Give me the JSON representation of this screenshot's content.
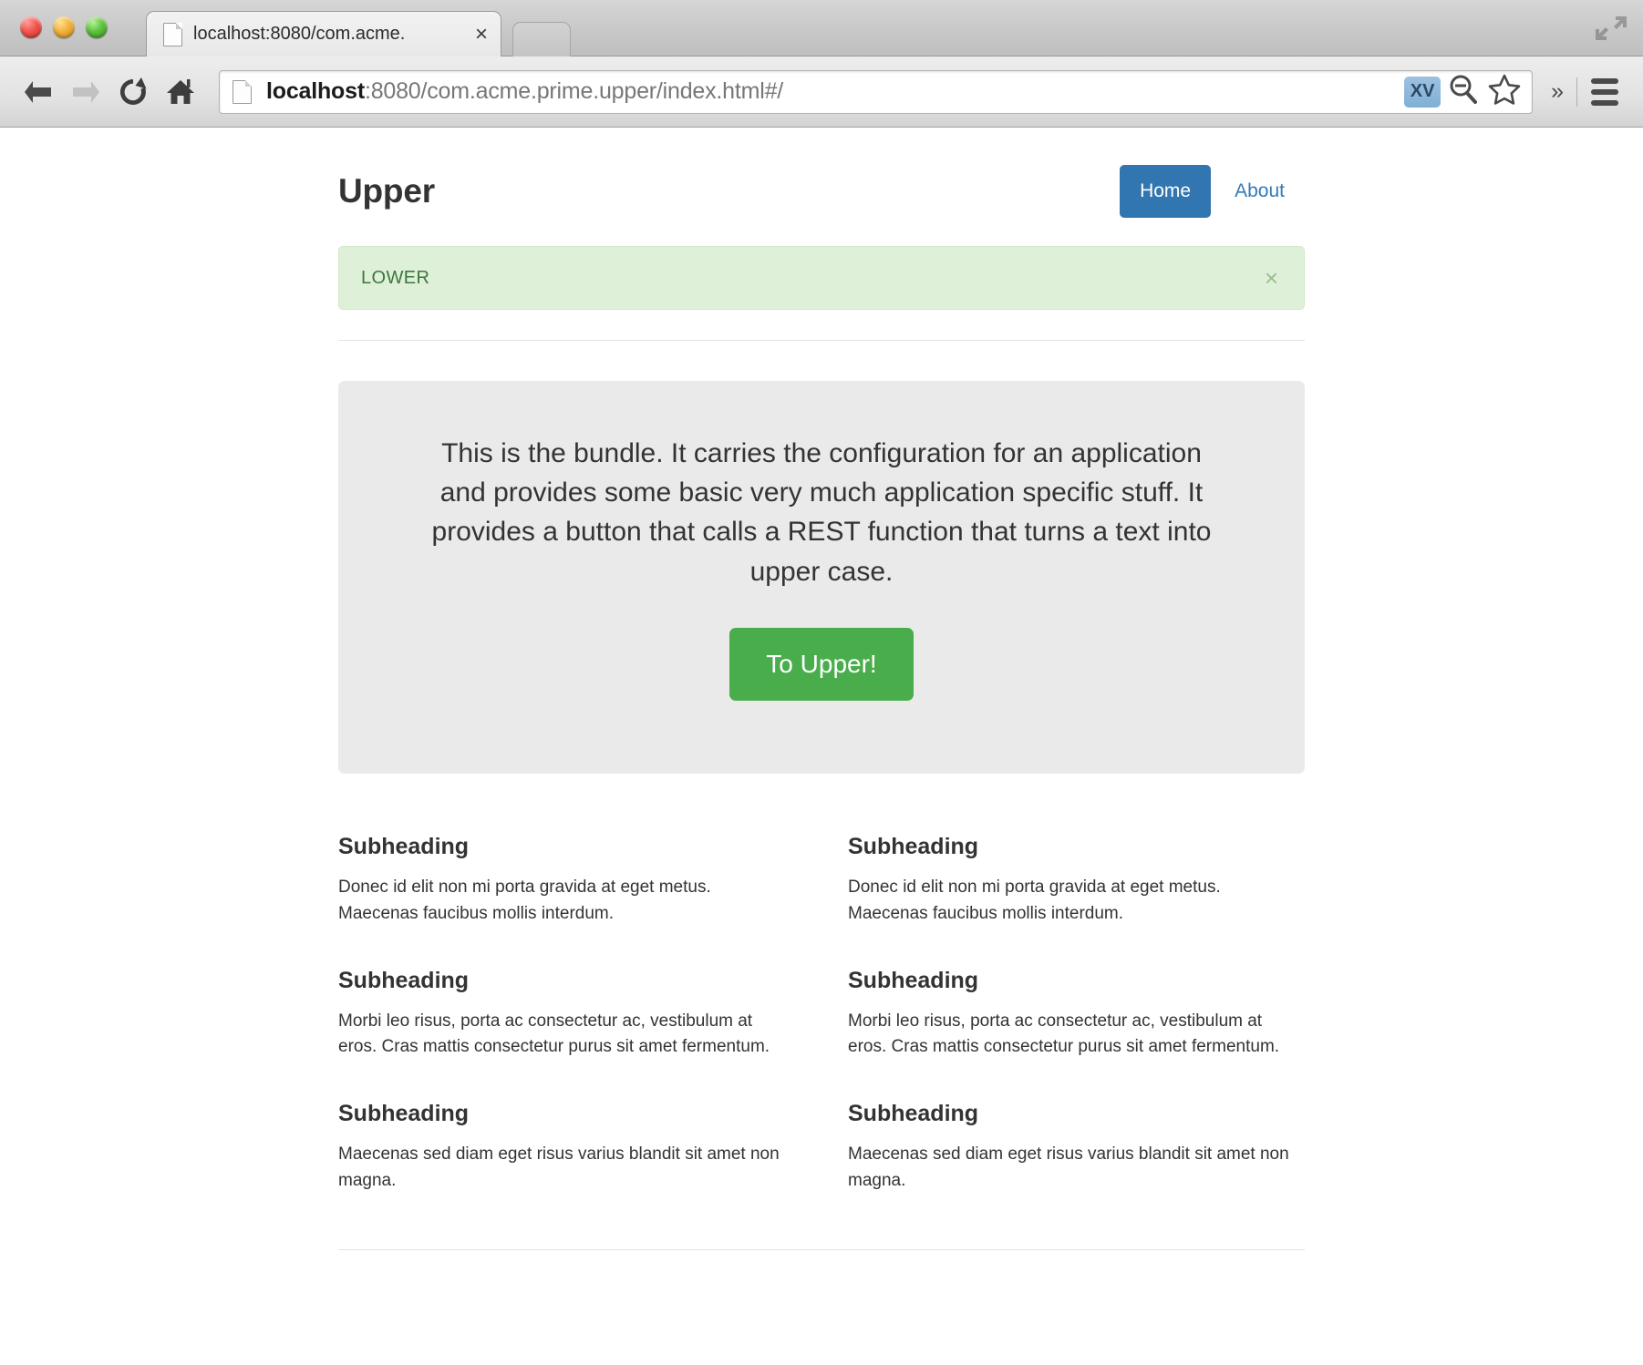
{
  "browser": {
    "tab": {
      "title": "localhost:8080/com.acme.",
      "close_label": "×",
      "favicon_name": "page-favicon"
    },
    "toolbar": {
      "back_label": "Back",
      "forward_label": "Forward",
      "reload_label": "Reload",
      "home_label": "Home",
      "url_prefix": "localhost",
      "url_rest": ":8080/com.acme.prime.upper/index.html#/",
      "url_full": "localhost:8080/com.acme.prime.upper/index.html#/",
      "xv_badge": "XV",
      "overflow_label": "»"
    }
  },
  "page": {
    "brand": "Upper",
    "nav": [
      {
        "label": "Home",
        "active": true
      },
      {
        "label": "About",
        "active": false
      }
    ],
    "alert": {
      "text": "LOWER",
      "close": "×",
      "bg_color": "#dff0d8",
      "text_color": "#3c763d"
    },
    "jumbotron": {
      "paragraph": "This is the bundle. It carries the configuration for an application and provides some basic very much application specific stuff. It provides a button that calls a REST function that turns a text into upper case.",
      "button_label": "To Upper!",
      "button_color": "#49ad4b",
      "bg_color": "#eaeaea"
    },
    "columns": [
      {
        "blocks": [
          {
            "heading": "Subheading",
            "body": "Donec id elit non mi porta gravida at eget metus. Maecenas faucibus mollis interdum."
          },
          {
            "heading": "Subheading",
            "body": "Morbi leo risus, porta ac consectetur ac, vestibulum at eros. Cras mattis consectetur purus sit amet fermentum."
          },
          {
            "heading": "Subheading",
            "body": "Maecenas sed diam eget risus varius blandit sit amet non magna."
          }
        ]
      },
      {
        "blocks": [
          {
            "heading": "Subheading",
            "body": "Donec id elit non mi porta gravida at eget metus. Maecenas faucibus mollis interdum."
          },
          {
            "heading": "Subheading",
            "body": "Morbi leo risus, porta ac consectetur ac, vestibulum at eros. Cras mattis consectetur purus sit amet fermentum."
          },
          {
            "heading": "Subheading",
            "body": "Maecenas sed diam eget risus varius blandit sit amet non magna."
          }
        ]
      }
    ],
    "accent_color": "#3276b1"
  }
}
